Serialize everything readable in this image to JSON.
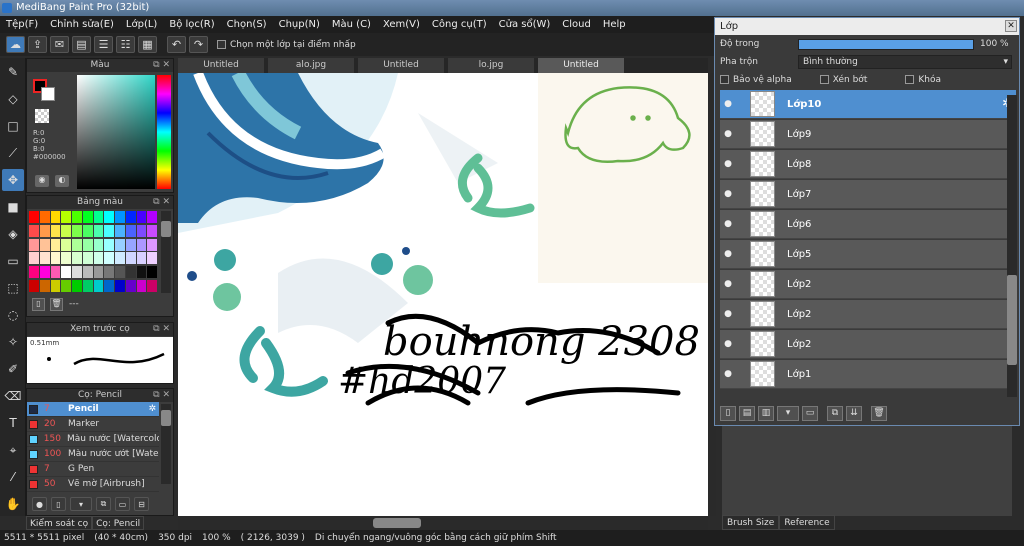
{
  "window": {
    "title": "MediBang Paint Pro (32bit)"
  },
  "menu": [
    "Tệp(F)",
    "Chỉnh sửa(E)",
    "Lớp(L)",
    "Bộ lọc(R)",
    "Chọn(S)",
    "Chụp(N)",
    "Màu (C)",
    "Xem(V)",
    "Công cụ(T)",
    "Cửa sổ(W)",
    "Cloud",
    "Help"
  ],
  "toolbar": {
    "checkbox_label": "Chọn một lớp tại điểm nhấp"
  },
  "color_panel": {
    "title": "Màu",
    "r": "R:0",
    "g": "G:0",
    "b": "B:0",
    "hex": "#000000"
  },
  "palette_panel": {
    "title": "Bảng màu",
    "footer": "---"
  },
  "preview_panel": {
    "title": "Xem trước cọ",
    "size": "0.51mm"
  },
  "brush_panel": {
    "title": "Cọ: Pencil",
    "items": [
      {
        "size": "7",
        "name": "Pencil",
        "color": "#1e2a44"
      },
      {
        "size": "20",
        "name": "Marker",
        "color": "#e33"
      },
      {
        "size": "150",
        "name": "Màu nước [Watercolo",
        "color": "#5fd3ff"
      },
      {
        "size": "100",
        "name": "Màu nước ướt [Wate",
        "color": "#5fd3ff"
      },
      {
        "size": "7",
        "name": "G Pen",
        "color": "#e33"
      },
      {
        "size": "50",
        "name": "Vẽ mờ [Airbrush]",
        "color": "#e33"
      }
    ]
  },
  "bottom_tabs": [
    "Kiểm soát cọ",
    "Cọ: Pencil"
  ],
  "doc_tabs": [
    "Untitled",
    "alo.jpg",
    "Untitled",
    "lo.jpg",
    "Untitled"
  ],
  "layer_window": {
    "title": "Lớp",
    "opacity_label": "Độ trong",
    "opacity_value": "100 %",
    "opacity": 1.0,
    "blend_label": "Pha trộn",
    "blend_value": "Bình thường",
    "protect_alpha": "Bảo vệ alpha",
    "clipping": "Xén bớt",
    "lock": "Khóa",
    "layers": [
      "Lớp10",
      "Lớp9",
      "Lớp8",
      "Lớp7",
      "Lớp6",
      "Lớp5",
      "Lớp2",
      "Lớp2",
      "Lớp2",
      "Lớp1"
    ]
  },
  "right_tabs": [
    "Brush Size",
    "Reference"
  ],
  "status": {
    "size": "5511 * 5511 pixel",
    "cm": "(40 * 40cm)",
    "dpi": "350 dpi",
    "zoom": "100 %",
    "coords": "( 2126, 3039 )",
    "hint": "Di chuyển ngang/vuông góc bằng cách giữ phím Shift"
  },
  "canvas_text": {
    "line1": "bouhnong 2308",
    "line2": "#hd2007"
  }
}
